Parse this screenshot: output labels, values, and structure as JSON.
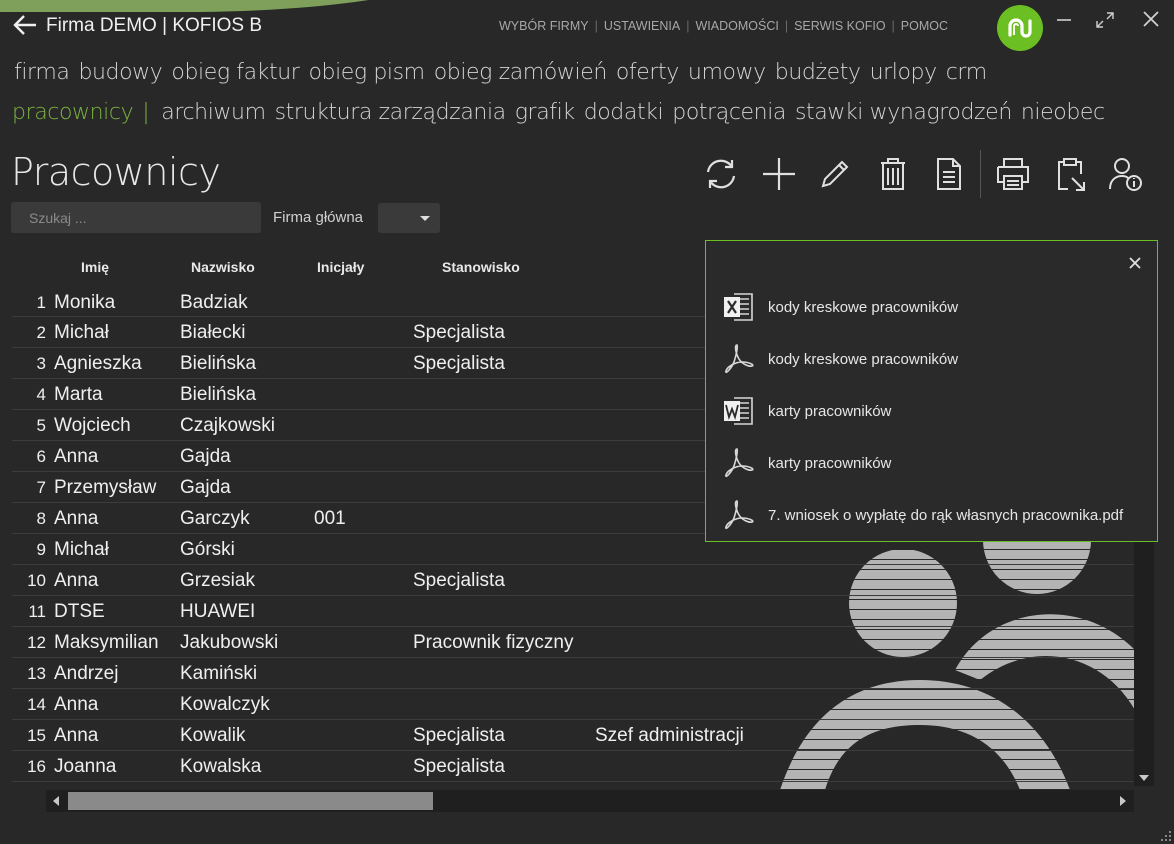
{
  "header": {
    "firm_title": "Firma DEMO | KOFIOS B",
    "menu": [
      "WYBÓR FIRMY",
      "USTAWIENIA",
      "WIADOMOŚCI",
      "SERWIS KOFIO",
      "POMOC"
    ],
    "logo_icon": "kofio-logo-icon",
    "accent_color": "#7cb342"
  },
  "nav": {
    "row1": [
      "firma",
      "budowy",
      "obieg faktur",
      "obieg pism",
      "obieg zamówień",
      "oferty",
      "umowy",
      "budżety",
      "urlopy",
      "crm"
    ],
    "row2_active": "pracownicy",
    "row2": [
      "archiwum",
      "struktura zarządzania",
      "grafik",
      "dodatki",
      "potrącenia",
      "stawki wynagrodzeń",
      "nieobec"
    ]
  },
  "page": {
    "title": "Pracownicy",
    "search_placeholder": "Szukaj ...",
    "firm_label": "Firma główna",
    "firm_value": ""
  },
  "toolbar": [
    "refresh-icon",
    "add-icon",
    "edit-icon",
    "delete-icon",
    "document-icon",
    "print-icon",
    "clipboard-export-icon",
    "user-info-icon"
  ],
  "table": {
    "headers": [
      "Imię",
      "Nazwisko",
      "Inicjały",
      "Stanowisko"
    ],
    "rows": [
      {
        "n": "1",
        "first": "Monika",
        "last": "Badziak",
        "ini": "",
        "pos": "",
        "extra": ""
      },
      {
        "n": "2",
        "first": "Michał",
        "last": "Białecki",
        "ini": "",
        "pos": "Specjalista",
        "extra": ""
      },
      {
        "n": "3",
        "first": "Agnieszka",
        "last": "Bielińska",
        "ini": "",
        "pos": "Specjalista",
        "extra": ""
      },
      {
        "n": "4",
        "first": "Marta",
        "last": "Bielińska",
        "ini": "",
        "pos": "",
        "extra": ""
      },
      {
        "n": "5",
        "first": "Wojciech",
        "last": "Czajkowski",
        "ini": "",
        "pos": "",
        "extra": ""
      },
      {
        "n": "6",
        "first": "Anna",
        "last": "Gajda",
        "ini": "",
        "pos": "",
        "extra": ""
      },
      {
        "n": "7",
        "first": "Przemysław",
        "last": "Gajda",
        "ini": "",
        "pos": "",
        "extra": ""
      },
      {
        "n": "8",
        "first": "Anna",
        "last": "Garczyk",
        "ini": "001",
        "pos": "",
        "extra": ""
      },
      {
        "n": "9",
        "first": "Michał",
        "last": "Górski",
        "ini": "",
        "pos": "",
        "extra": ""
      },
      {
        "n": "10",
        "first": "Anna",
        "last": "Grzesiak",
        "ini": "",
        "pos": "Specjalista",
        "extra": ""
      },
      {
        "n": "11",
        "first": "DTSE",
        "last": "HUAWEI",
        "ini": "",
        "pos": "",
        "extra": ""
      },
      {
        "n": "12",
        "first": "Maksymilian",
        "last": "Jakubowski",
        "ini": "",
        "pos": "Pracownik fizyczny",
        "extra": ""
      },
      {
        "n": "13",
        "first": "Andrzej",
        "last": "Kamiński",
        "ini": "",
        "pos": "",
        "extra": ""
      },
      {
        "n": "14",
        "first": "Anna",
        "last": "Kowalczyk",
        "ini": "",
        "pos": "",
        "extra": ""
      },
      {
        "n": "15",
        "first": "Anna",
        "last": "Kowalik",
        "ini": "",
        "pos": "Specjalista",
        "extra": "Szef administracji"
      },
      {
        "n": "16",
        "first": "Joanna",
        "last": "Kowalska",
        "ini": "",
        "pos": "Specjalista",
        "extra": ""
      }
    ]
  },
  "popup": {
    "items": [
      {
        "icon": "excel-icon",
        "label": "kody kreskowe pracowników"
      },
      {
        "icon": "pdf-icon",
        "label": "kody kreskowe pracowników"
      },
      {
        "icon": "word-icon",
        "label": "karty pracowników"
      },
      {
        "icon": "pdf-icon",
        "label": "karty pracowników"
      },
      {
        "icon": "pdf-icon",
        "label": "7. wniosek o wypłatę do rąk własnych pracownika.pdf"
      }
    ]
  }
}
